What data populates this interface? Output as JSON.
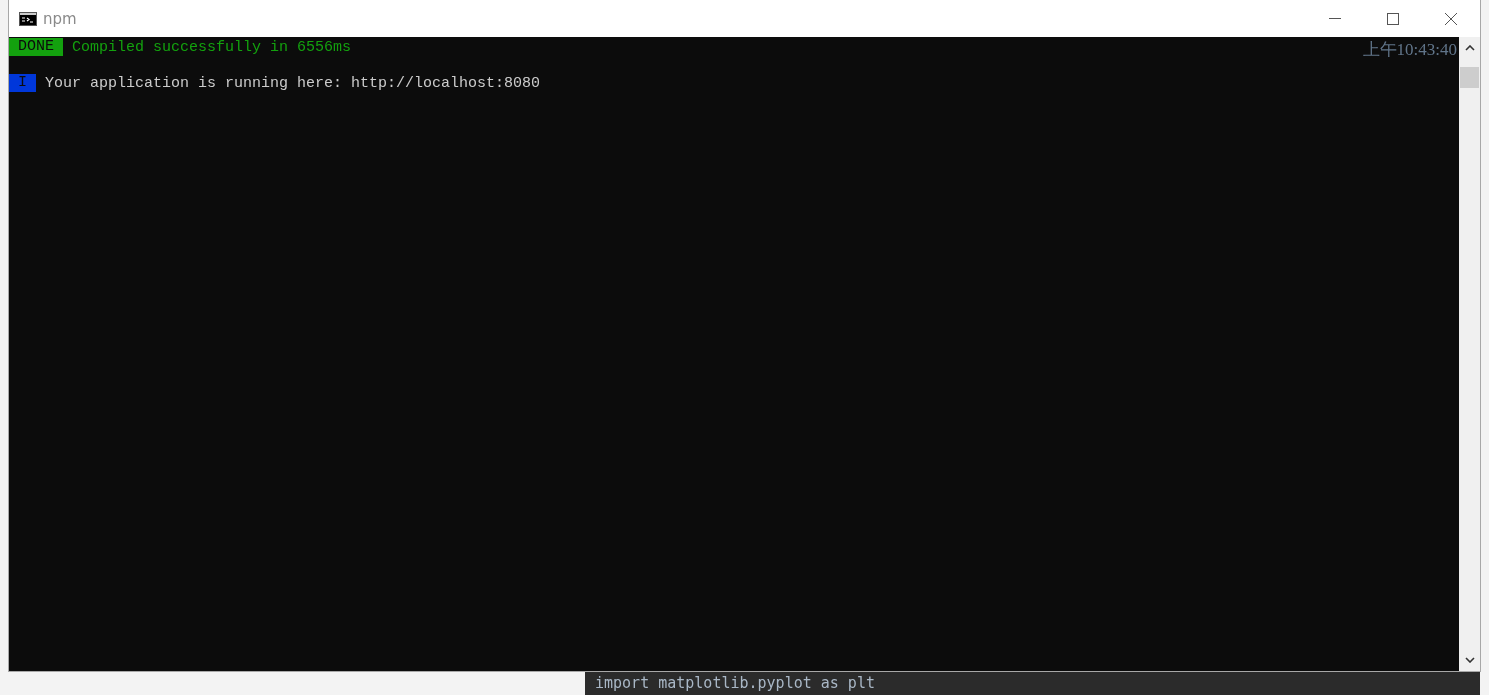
{
  "window": {
    "title": "npm"
  },
  "console": {
    "lines": [
      {
        "kind": "success",
        "badge": "DONE",
        "text": "Compiled successfully in 6556ms",
        "time": "上午10:43:40"
      },
      {
        "kind": "info",
        "badge": "I",
        "text": "Your application is running here: http://localhost:8080"
      }
    ]
  },
  "background": {
    "code_line": "import matplotlib.pyplot as plt"
  }
}
